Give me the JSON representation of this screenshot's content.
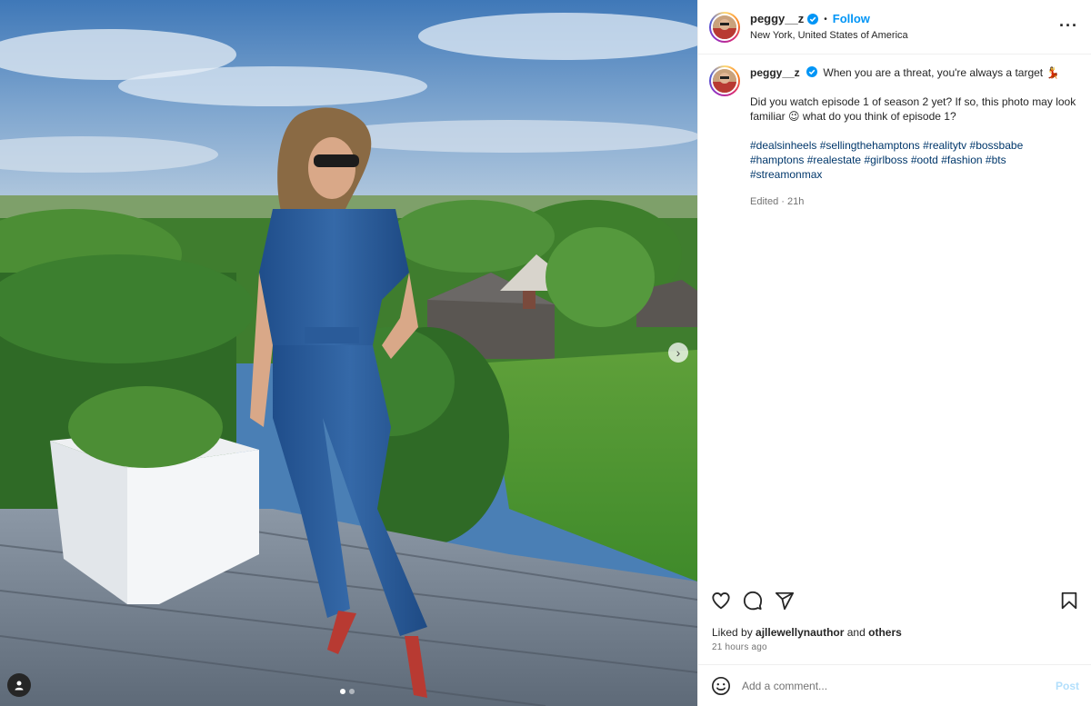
{
  "post": {
    "username": "peggy__z",
    "follow_label": "Follow",
    "location": "New York, United States of America",
    "more_icon": "more-horizontal-icon",
    "bullet": "•"
  },
  "caption": {
    "username": "peggy__z",
    "headline": "When you are a threat, you're always a target 💃",
    "paragraph": "Did you watch episode 1 of season 2 yet? If so, this photo may look familiar 😉 what do you think of episode 1?",
    "hashtags": [
      "#dealsinheels",
      "#sellingthehamptons",
      "#realitytv",
      "#bossbabe",
      "#hamptons",
      "#realestate",
      "#girlboss",
      "#ootd",
      "#fashion",
      "#bts",
      "#streamonmax"
    ],
    "edited": "Edited · 21h"
  },
  "actions": {
    "icons": [
      "heart-icon",
      "comment-icon",
      "share-icon",
      "save-icon"
    ]
  },
  "likes": {
    "prefix": "Liked by",
    "user": "ajllewellynauthor",
    "connector": "and",
    "others": "others"
  },
  "timestamp": "21 hours ago",
  "comment_box": {
    "placeholder": "Add a comment...",
    "post_label": "Post"
  },
  "carousel": {
    "slide_count": 2,
    "active_index": 0,
    "next_icon": "chevron-right-icon"
  },
  "colors": {
    "link_blue": "#0095f6",
    "hashtag": "#00376b",
    "muted": "#737373"
  }
}
